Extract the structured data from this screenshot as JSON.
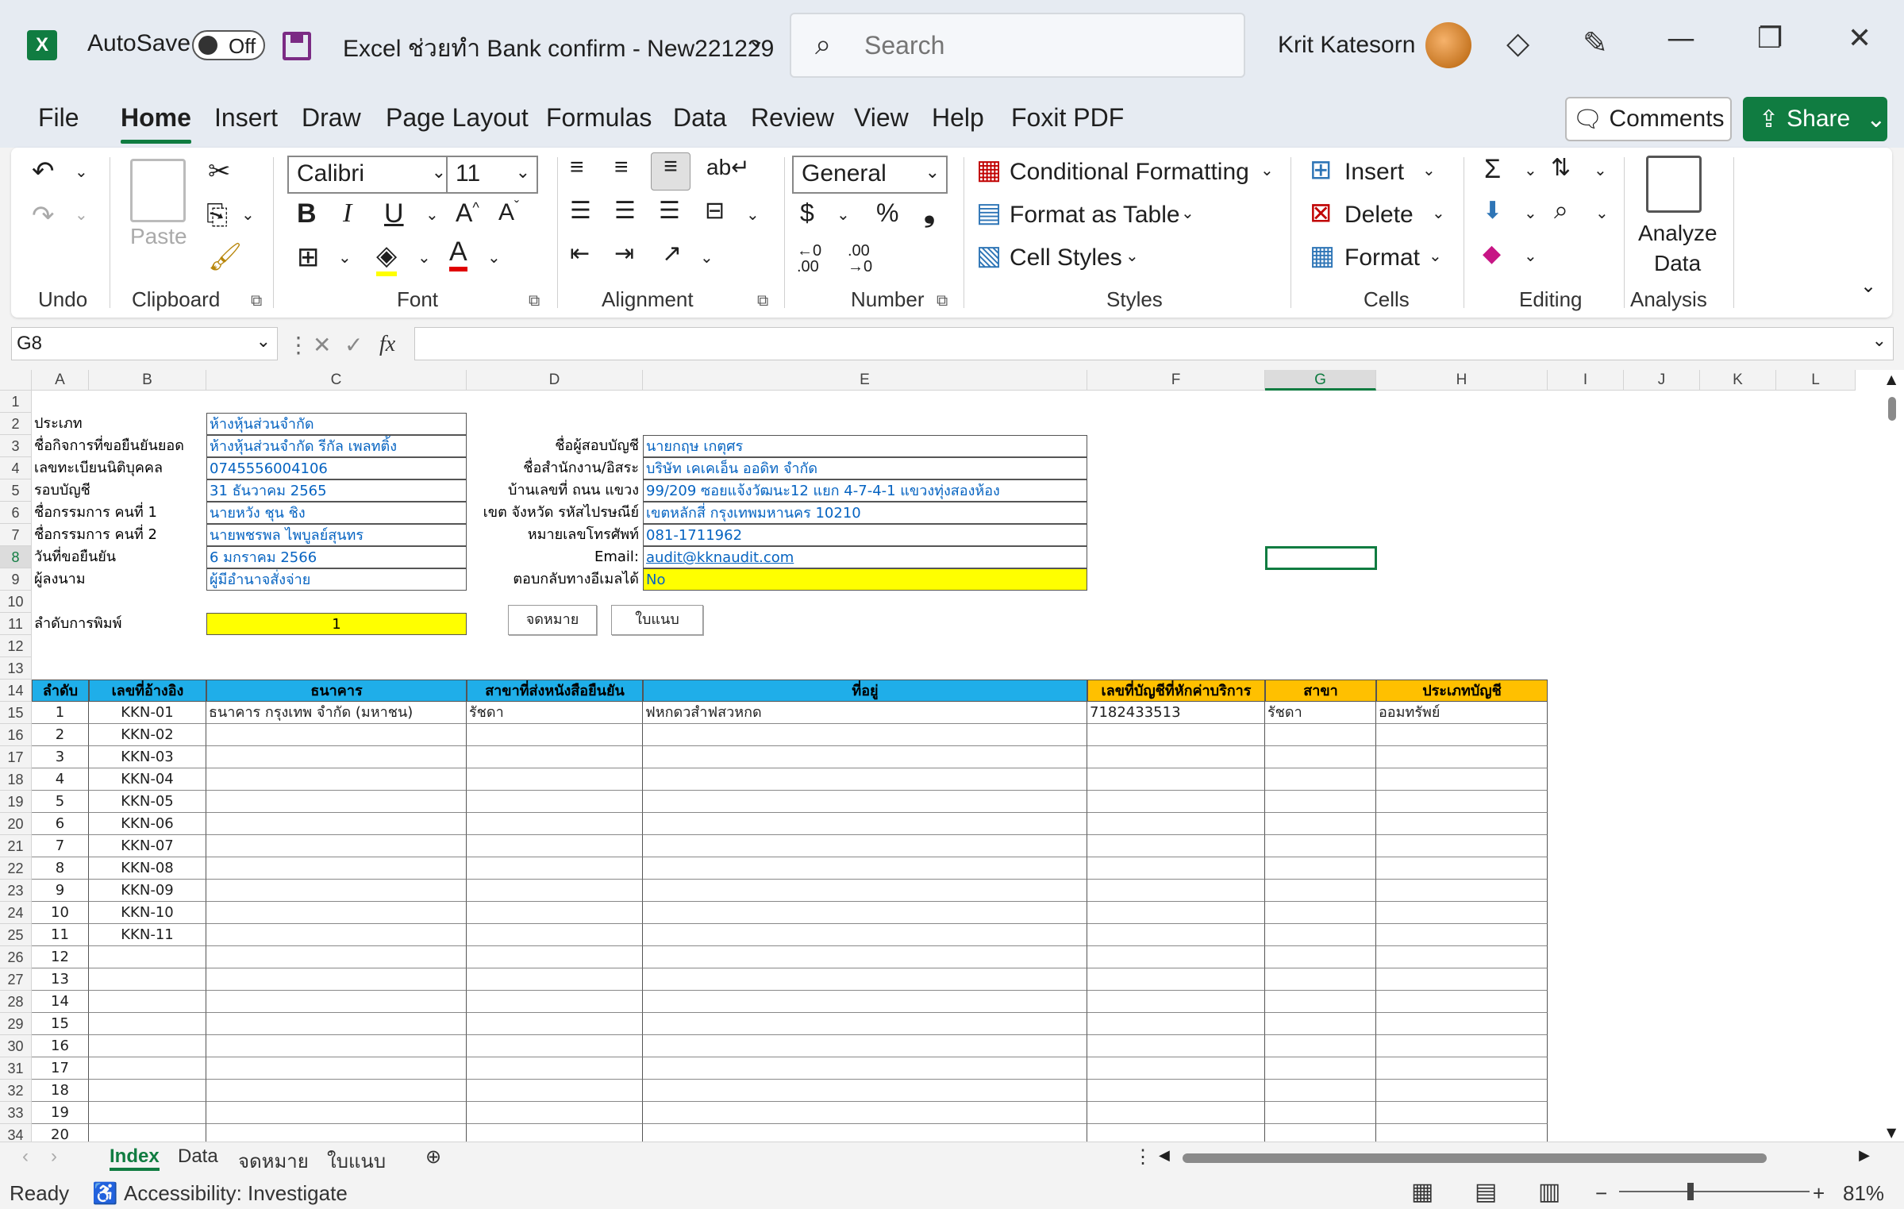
{
  "titlebar": {
    "autosave_label": "AutoSave",
    "autosave_state": "Off",
    "doc_title": "Excel ช่วยทำ Bank confirm - New221229",
    "search_placeholder": "Search",
    "user_name": "Krit Katesorn"
  },
  "tabs": [
    "File",
    "Home",
    "Insert",
    "Draw",
    "Page Layout",
    "Formulas",
    "Data",
    "Review",
    "View",
    "Help",
    "Foxit PDF"
  ],
  "comments_label": "Comments",
  "share_label": "Share",
  "ribbon": {
    "undo_label": "Undo",
    "clipboard_label": "Clipboard",
    "paste_label": "Paste",
    "font_label": "Font",
    "font_name": "Calibri",
    "font_size": "11",
    "alignment_label": "Alignment",
    "number_label": "Number",
    "number_format": "General",
    "styles_label": "Styles",
    "conditional_formatting": "Conditional Formatting",
    "format_as_table": "Format as Table",
    "cell_styles": "Cell Styles",
    "cells_label": "Cells",
    "insert": "Insert",
    "delete": "Delete",
    "format": "Format",
    "editing_label": "Editing",
    "analyze_data_1": "Analyze",
    "analyze_data_2": "Data",
    "analysis_label": "Analysis"
  },
  "formula_bar": {
    "name_box": "G8",
    "formula": ""
  },
  "columns": [
    "A",
    "B",
    "C",
    "D",
    "E",
    "F",
    "G",
    "H",
    "I",
    "J",
    "K",
    "L"
  ],
  "info_left": [
    {
      "label": "ประเภท",
      "value": "ห้างหุ้นส่วนจำกัด"
    },
    {
      "label": "ชื่อกิจการที่ขอยืนยันยอด",
      "value": "ห้างหุ้นส่วนจำกัด รีกัล เพลทติ้ง"
    },
    {
      "label": "เลขทะเบียนนิติบุคคล",
      "value": "0745556004106"
    },
    {
      "label": "รอบบัญชี",
      "value": "31 ธันวาคม 2565"
    },
    {
      "label": "ชื่อกรรมการ คนที่ 1",
      "value": "นายหวัง ชุน ชิง"
    },
    {
      "label": "ชื่อกรรมการ คนที่ 2",
      "value": "นายพชรพล ไพบูลย์สุนทร"
    },
    {
      "label": "วันที่ขอยืนยัน",
      "value": "6 มกราคม 2566"
    },
    {
      "label": "ผู้ลงนาม",
      "value": "ผู้มีอำนาจสั่งจ่าย"
    }
  ],
  "info_right": [
    {
      "label": "ชื่อผู้สอบบัญชี",
      "value": "นายกฤษ  เกตุศร"
    },
    {
      "label": "ชื่อสำนักงาน/อิสระ",
      "value": "บริษัท เคเคเอ็น ออดิท จำกัด"
    },
    {
      "label": "บ้านเลขที่ ถนน แขวง",
      "value": "99/209 ซอยแจ้งวัฒนะ12 แยก 4-7-4-1 แขวงทุ่งสองห้อง"
    },
    {
      "label": "เขต จังหวัด รหัสไปรษณีย์",
      "value": "เขตหลักสี่ กรุงเทพมหานคร 10210"
    },
    {
      "label": "หมายเลขโทรศัพท์",
      "value": "081-1711962"
    },
    {
      "label": "Email:",
      "value": "audit@kknaudit.com"
    },
    {
      "label": "ตอบกลับทางอีเมลได้",
      "value": "No"
    }
  ],
  "print_order": {
    "label": "ลำดับการพิมพ์",
    "value": "1"
  },
  "buttons": {
    "letter": "จดหมาย",
    "form": "ใบแนบ"
  },
  "table": {
    "headers": [
      "ลำดับ",
      "เลขที่อ้างอิง",
      "ธนาคาร",
      "สาขาที่ส่งหนังสือยืนยัน",
      "ที่อยู่",
      "เลขที่บัญชีที่หักค่าบริการ",
      "สาขา",
      "ประเภทบัญชี"
    ],
    "first_row": {
      "bank": "ธนาคาร กรุงเทพ จำกัด (มหาชน)",
      "branch": "รัชดา",
      "address": "ฟหกดวสำฟสวหกด",
      "account": "7182433513",
      "acc_branch": "รัชดา",
      "acc_type": "ออมทรัพย์"
    },
    "seq": [
      "1",
      "2",
      "3",
      "4",
      "5",
      "6",
      "7",
      "8",
      "9",
      "10",
      "11",
      "12",
      "13",
      "14",
      "15",
      "16",
      "17",
      "18",
      "19",
      "20"
    ],
    "refs": [
      "KKN-01",
      "KKN-02",
      "KKN-03",
      "KKN-04",
      "KKN-05",
      "KKN-06",
      "KKN-07",
      "KKN-08",
      "KKN-09",
      "KKN-10",
      "KKN-11"
    ]
  },
  "row_numbers": [
    "1",
    "2",
    "3",
    "4",
    "5",
    "6",
    "7",
    "8",
    "9",
    "10",
    "11",
    "12",
    "13",
    "14",
    "15",
    "16",
    "17",
    "18",
    "19",
    "20",
    "21",
    "22",
    "23",
    "24",
    "25",
    "26",
    "27",
    "28",
    "29",
    "30",
    "31",
    "32",
    "33",
    "34"
  ],
  "sheets": [
    "Index",
    "Data",
    "จดหมาย",
    "ใบแนบ"
  ],
  "status": {
    "ready": "Ready",
    "accessibility": "Accessibility: Investigate",
    "zoom": "81%"
  }
}
